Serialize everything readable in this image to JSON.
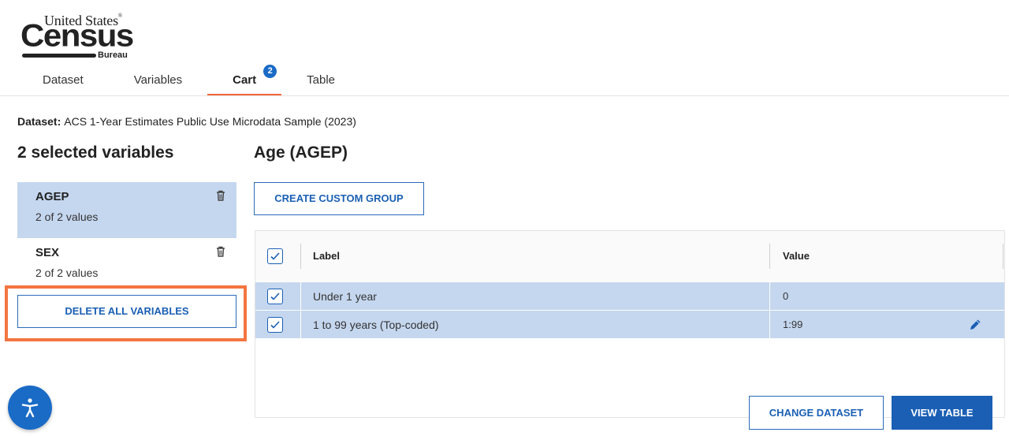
{
  "logo": {
    "line1": "United States",
    "reg": "®",
    "line2": "Census",
    "line3": "Bureau"
  },
  "tabs": [
    {
      "label": "Dataset"
    },
    {
      "label": "Variables"
    },
    {
      "label": "Cart",
      "badge": "2",
      "active": true
    },
    {
      "label": "Table"
    }
  ],
  "dataset": {
    "prefix": "Dataset:",
    "name": "ACS 1-Year Estimates Public Use Microdata Sample (2023)"
  },
  "left_panel": {
    "title": "2 selected variables",
    "variables": [
      {
        "name": "AGEP",
        "values": "2 of 2 values",
        "selected": true
      },
      {
        "name": "SEX",
        "values": "2 of 2 values",
        "selected": false
      }
    ],
    "delete_all_label": "DELETE ALL VARIABLES"
  },
  "right_panel": {
    "title": "Age (AGEP)",
    "custom_group_label": "CREATE CUSTOM GROUP",
    "table": {
      "headers": {
        "label": "Label",
        "value": "Value"
      },
      "rows": [
        {
          "label": "Under 1 year",
          "value": "0",
          "checked": true
        },
        {
          "label": "1 to 99 years (Top-coded)",
          "value": "1:99",
          "checked": true
        }
      ]
    }
  },
  "footer": {
    "change_dataset_label": "CHANGE DATASET",
    "view_table_label": "VIEW TABLE"
  },
  "colors": {
    "accent": "#1a5fb4",
    "tab_underline": "#f2683a",
    "highlight": "#f47541",
    "row_selected": "#c5d7ef"
  },
  "icons": {
    "trash": "trash-icon",
    "edit": "pencil-icon",
    "checkbox": "checkbox-icon",
    "accessibility": "accessibility-icon"
  }
}
